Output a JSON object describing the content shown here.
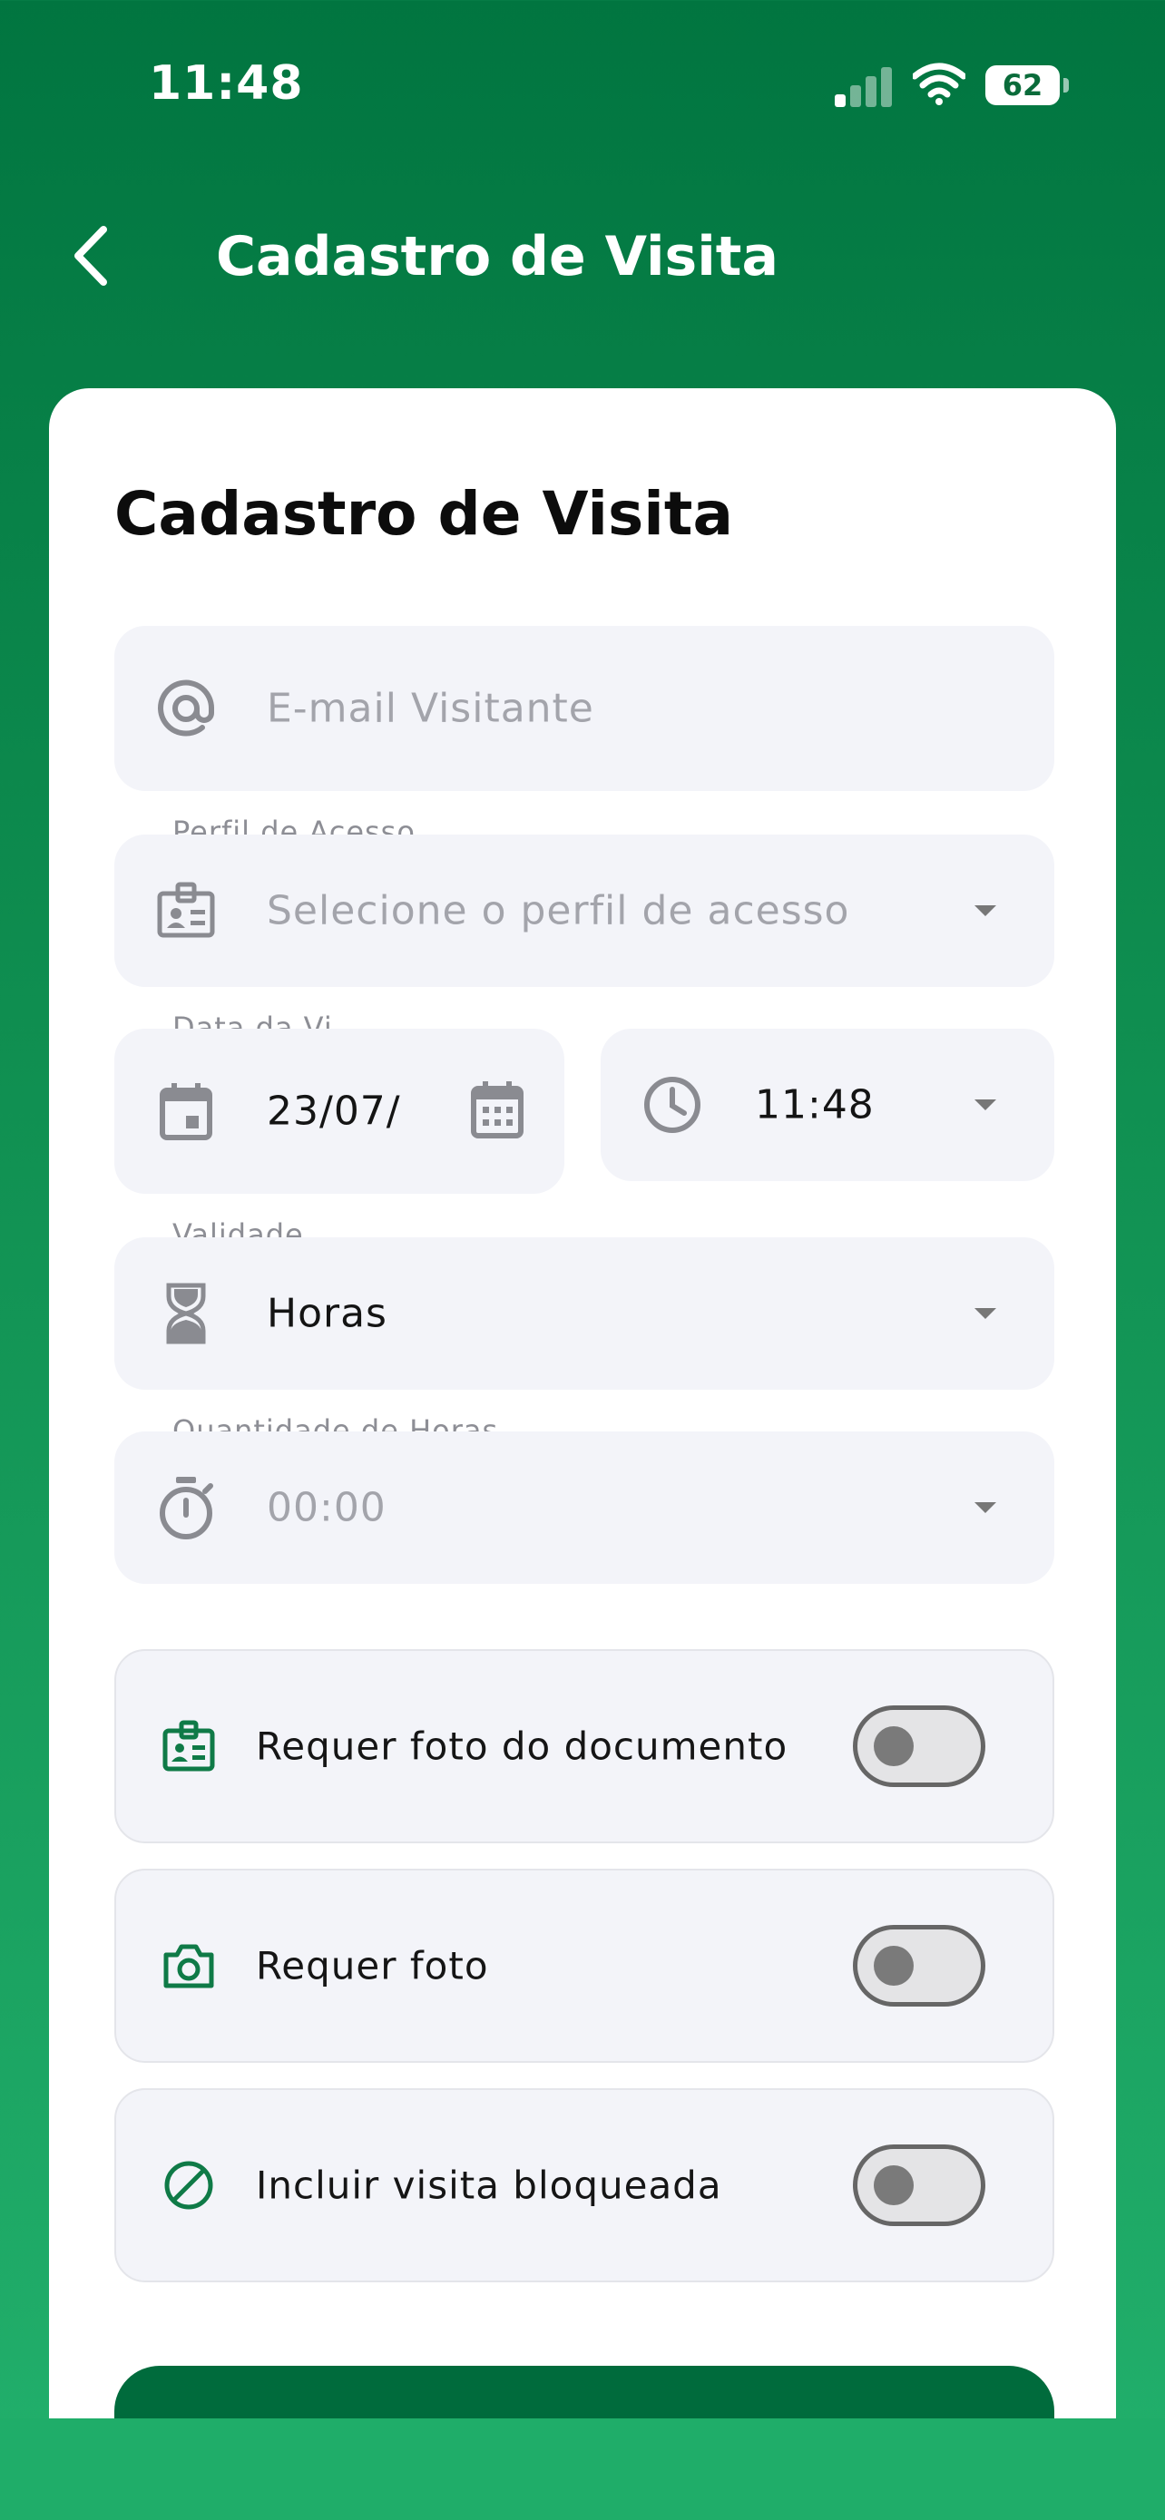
{
  "status_bar": {
    "time": "11:48",
    "battery": "62",
    "battery_level_percent": 62
  },
  "header": {
    "title": "Cadastro de Visita",
    "back_icon": "chevron-left-icon"
  },
  "form": {
    "title": "Cadastro de Visita",
    "email": {
      "placeholder": "E-mail Visitante",
      "icon": "at-icon"
    },
    "access_profile": {
      "label": "Perfil de Acesso",
      "placeholder": "Selecione o perfil de acesso",
      "icon": "badge-icon"
    },
    "visit_date": {
      "label": "Data da Vi...",
      "value": "23/07/",
      "icon": "calendar-icon",
      "picker_icon": "calendar-grid-icon"
    },
    "visit_time": {
      "value": "11:48",
      "icon": "clock-icon"
    },
    "validity": {
      "label": "Validade",
      "value": "Horas",
      "icon": "hourglass-icon"
    },
    "hours_quantity": {
      "label": "Quantidade de Horas",
      "placeholder": "00:00",
      "icon": "stopwatch-icon"
    },
    "toggles": [
      {
        "label": "Requer foto do documento",
        "icon": "id-card-icon",
        "enabled": false
      },
      {
        "label": "Requer foto",
        "icon": "camera-icon",
        "enabled": false
      },
      {
        "label": "Incluir visita bloqueada",
        "icon": "block-icon",
        "enabled": false
      }
    ]
  },
  "colors": {
    "brand_green": "#006b3c",
    "icon_green": "#0f7a47",
    "field_bg": "#f3f4f9"
  }
}
